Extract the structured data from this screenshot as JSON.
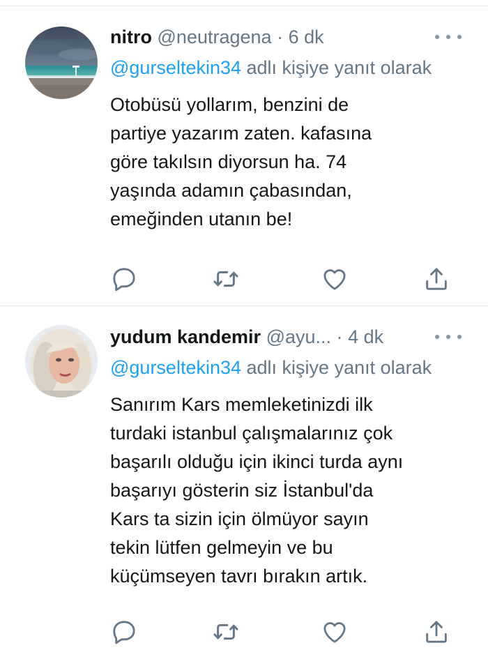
{
  "tweets": [
    {
      "name": "nitro",
      "handle": "@neutragena",
      "separator": "·",
      "time": "6 dk",
      "reply_mention": "@gurseltekin34",
      "reply_suffix": " adlı kişiye yanıt olarak",
      "lines": [
        "Otobüsü yollarım, benzini de",
        "partiye yazarım zaten. kafasına",
        "göre takılsın diyorsun ha. 74",
        "yaşında adamın çabasından,",
        "emeğinden utanın be!"
      ],
      "avatar_icon": "beach-storm-photo"
    },
    {
      "name": "yudum kandemir",
      "handle": "@ayu...",
      "separator": "·",
      "time": "4 dk",
      "reply_mention": "@gurseltekin34",
      "reply_suffix": " adlı kişiye yanıt olarak",
      "lines": [
        "Sanırım Kars memleketinizdi ilk",
        "turdaki istanbul çalışmalarınız çok",
        "başarılı olduğu için ikinci turda aynı",
        "başarıyı gösterin siz İstanbul'da",
        "Kars ta sizin için ölmüyor sayın",
        "tekin lütfen gelmeyin ve bu",
        "küçümseyen tavrı bırakın artık."
      ],
      "avatar_icon": "profile-photo-blonde-woman"
    }
  ],
  "icons": {
    "reply": "reply-icon",
    "retweet": "retweet-icon",
    "like": "like-icon",
    "share": "share-icon",
    "more": "more-icon"
  },
  "colors": {
    "link": "#1da1f2",
    "secondary_text": "#657786",
    "icon": "#657786",
    "divider": "#e1e8ed"
  }
}
